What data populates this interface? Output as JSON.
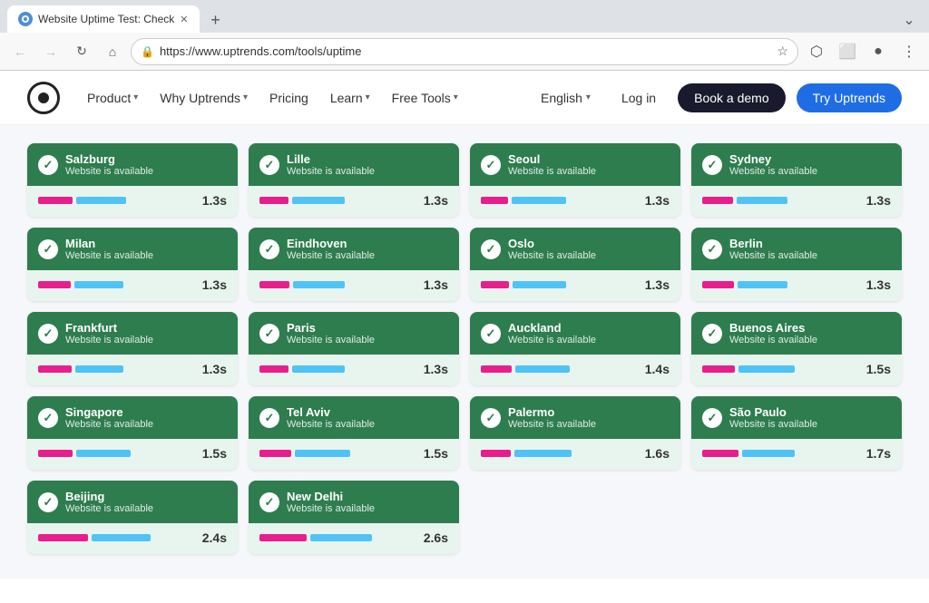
{
  "browser": {
    "tab_title": "Website Uptime Test: Check",
    "url": "https://www.uptrends.com/tools/uptime",
    "new_tab_label": "+"
  },
  "nav": {
    "product_label": "Product",
    "why_label": "Why Uptrends",
    "pricing_label": "Pricing",
    "learn_label": "Learn",
    "tools_label": "Free Tools",
    "lang_label": "English",
    "login_label": "Log in",
    "demo_label": "Book a demo",
    "try_label": "Try Uptrends"
  },
  "cards": [
    {
      "city": "Salzburg",
      "status": "Website is available",
      "time": "1.3s",
      "pink_w": 38,
      "blue_w": 55
    },
    {
      "city": "Lille",
      "status": "Website is available",
      "time": "1.3s",
      "pink_w": 32,
      "blue_w": 58
    },
    {
      "city": "Seoul",
      "status": "Website is available",
      "time": "1.3s",
      "pink_w": 30,
      "blue_w": 60
    },
    {
      "city": "Sydney",
      "status": "Website is available",
      "time": "1.3s",
      "pink_w": 34,
      "blue_w": 56
    },
    {
      "city": "Milan",
      "status": "Website is available",
      "time": "1.3s",
      "pink_w": 36,
      "blue_w": 54
    },
    {
      "city": "Eindhoven",
      "status": "Website is available",
      "time": "1.3s",
      "pink_w": 33,
      "blue_w": 57
    },
    {
      "city": "Oslo",
      "status": "Website is available",
      "time": "1.3s",
      "pink_w": 31,
      "blue_w": 59
    },
    {
      "city": "Berlin",
      "status": "Website is available",
      "time": "1.3s",
      "pink_w": 35,
      "blue_w": 55
    },
    {
      "city": "Frankfurt",
      "status": "Website is available",
      "time": "1.3s",
      "pink_w": 37,
      "blue_w": 53
    },
    {
      "city": "Paris",
      "status": "Website is available",
      "time": "1.3s",
      "pink_w": 32,
      "blue_w": 58
    },
    {
      "city": "Auckland",
      "status": "Website is available",
      "time": "1.4s",
      "pink_w": 34,
      "blue_w": 60
    },
    {
      "city": "Buenos Aires",
      "status": "Website is available",
      "time": "1.5s",
      "pink_w": 36,
      "blue_w": 62
    },
    {
      "city": "Singapore",
      "status": "Website is available",
      "time": "1.5s",
      "pink_w": 38,
      "blue_w": 60
    },
    {
      "city": "Tel Aviv",
      "status": "Website is available",
      "time": "1.5s",
      "pink_w": 35,
      "blue_w": 61
    },
    {
      "city": "Palermo",
      "status": "Website is available",
      "time": "1.6s",
      "pink_w": 33,
      "blue_w": 63
    },
    {
      "city": "São Paulo",
      "status": "Website is available",
      "time": "1.7s",
      "pink_w": 40,
      "blue_w": 58
    },
    {
      "city": "Beijing",
      "status": "Website is available",
      "time": "2.4s",
      "pink_w": 55,
      "blue_w": 65
    },
    {
      "city": "New Delhi",
      "status": "Website is available",
      "time": "2.6s",
      "pink_w": 52,
      "blue_w": 68
    }
  ]
}
